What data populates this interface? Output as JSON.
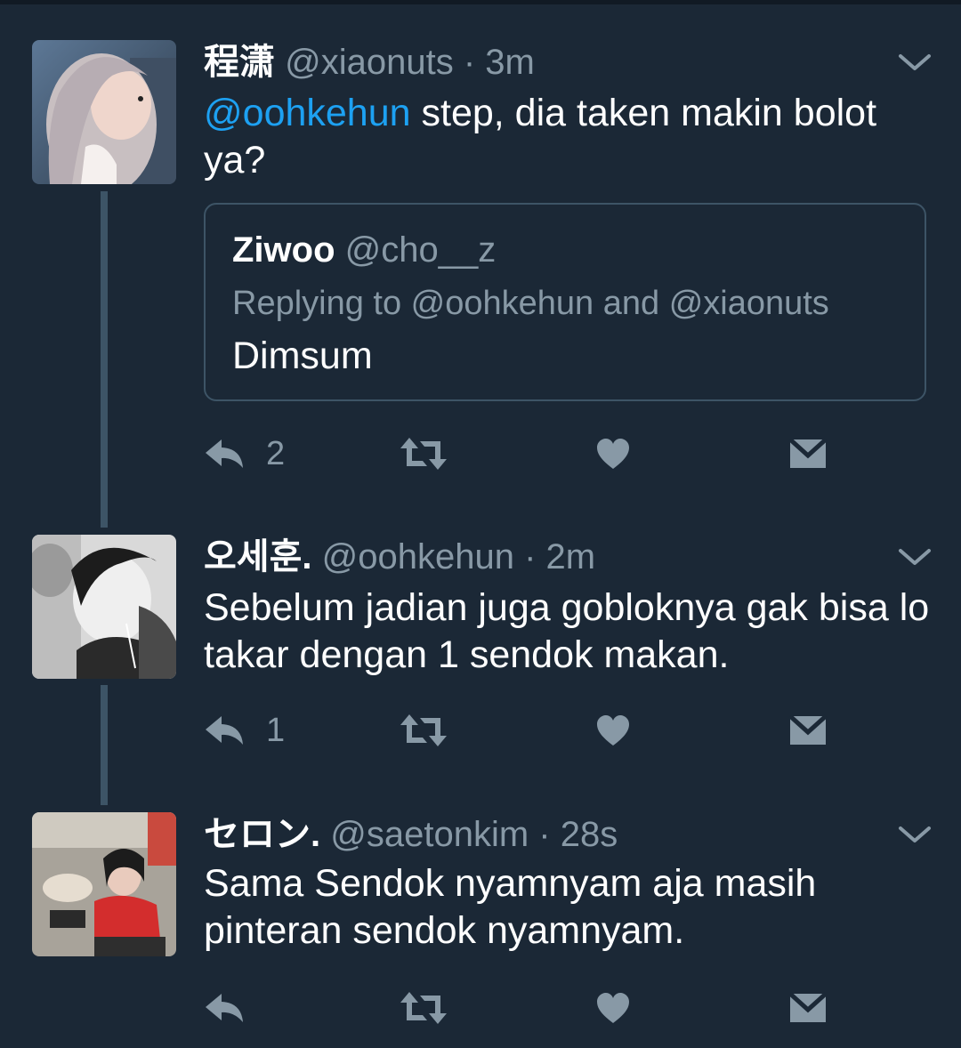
{
  "colors": {
    "background": "#1b2836",
    "text": "#ffffff",
    "muted": "#8899a6",
    "mention": "#1da1f2",
    "thread_line": "#3d5466"
  },
  "tweets": [
    {
      "display_name": "程潇",
      "handle": "@xiaonuts",
      "time": "3m",
      "separator": "·",
      "mention": "@oohkehun",
      "text": " step, dia taken makin bolot ya?",
      "quote": {
        "display_name": "Ziwoo",
        "handle": "@cho__z",
        "replying": "Replying to @oohkehun and @xiaonuts",
        "text": "Dimsum"
      },
      "reply_count": "2",
      "icons": [
        "reply-icon",
        "retweet-icon",
        "like-icon",
        "dm-icon",
        "chevron-down-icon"
      ]
    },
    {
      "display_name": "오세훈.",
      "handle": "@oohkehun",
      "time": "2m",
      "separator": "·",
      "text": "Sebelum jadian juga gobloknya gak bisa lo takar dengan 1 sendok makan.",
      "reply_count": "1"
    },
    {
      "display_name": "セロン.",
      "handle": "@saetonkim",
      "time": "28s",
      "separator": "·",
      "text": "Sama Sendok nyamnyam aja masih pinteran sendok nyamnyam.",
      "reply_count": ""
    }
  ]
}
